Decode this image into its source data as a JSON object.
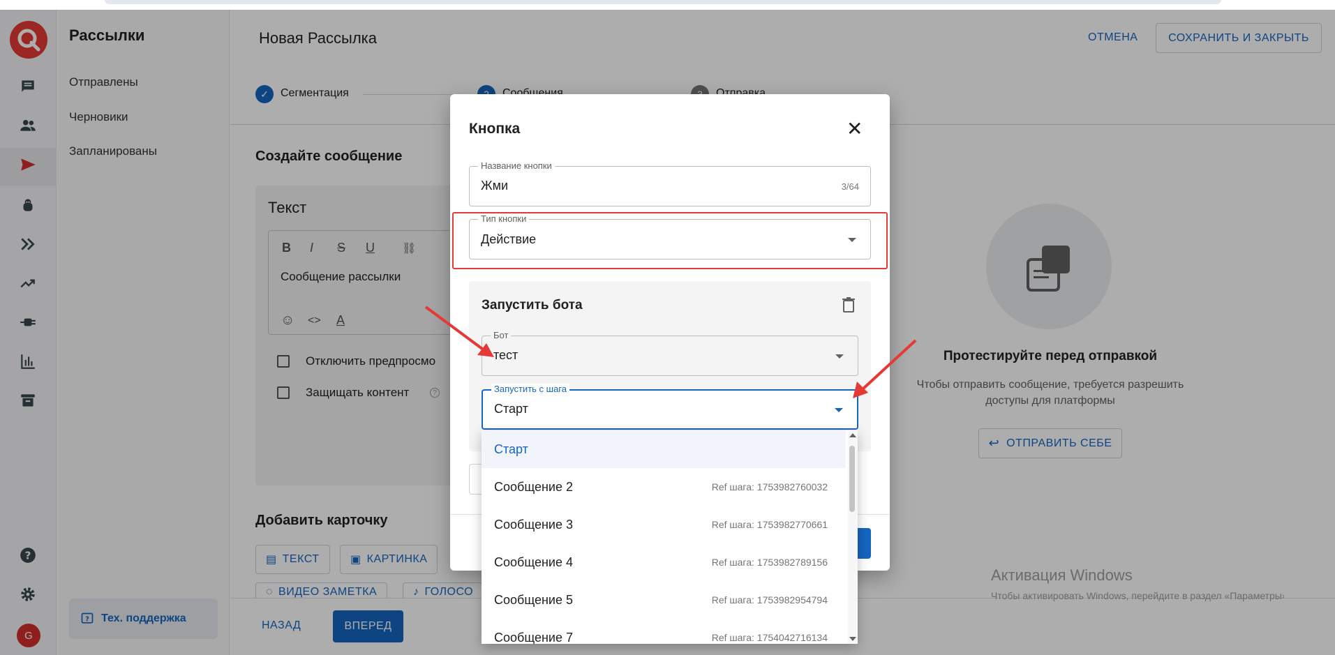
{
  "colors": {
    "accent": "#1565c0",
    "danger": "#e53935"
  },
  "rail": {
    "icons": [
      "chat-icon",
      "people-icon",
      "send-icon",
      "bot-icon",
      "forward-icon",
      "trending-icon",
      "plug-icon",
      "bar-chart-icon",
      "archive-icon",
      "help-icon",
      "gear-icon"
    ],
    "avatar_letter": "G"
  },
  "sidebar": {
    "title": "Рассылки",
    "items": [
      {
        "label": "Отправлены"
      },
      {
        "label": "Черновики"
      },
      {
        "label": "Запланированы"
      }
    ],
    "support_label": "Тех. поддержка"
  },
  "header": {
    "title": "Новая Рассылка",
    "cancel_label": "ОТМЕНА",
    "save_label": "СОХРАНИТЬ И ЗАКРЫТЬ"
  },
  "stepper": {
    "steps": [
      {
        "label": "Сегментация",
        "num": "✓"
      },
      {
        "label": "Сообщения",
        "num": "2"
      },
      {
        "label": "Отправка",
        "num": "3"
      }
    ]
  },
  "editor": {
    "section_title": "Создайте сообщение",
    "card_title": "Текст",
    "message_text": "Сообщение рассылки",
    "checkbox_disable_preview": "Отключить предпросмо",
    "checkbox_protect": "Защищать контент"
  },
  "add_card": {
    "title": "Добавить карточку",
    "chips": [
      "ТЕКСТ",
      "КАРТИНКА",
      "ВИДЕО ЗАМЕТКА",
      "ГОЛОСО"
    ]
  },
  "footer": {
    "back_label": "НАЗАД",
    "next_label": "ВПЕРЕД"
  },
  "preview": {
    "title": "Протестируйте перед отправкой",
    "description": "Чтобы отправить сообщение, требуется разрешить доступы для платформы",
    "send_self_label": "ОТПРАВИТЬ СЕБЕ",
    "watermark_title": "Активация Windows",
    "watermark_sub": "Чтобы активировать Windows, перейдите в раздел «Параметры»."
  },
  "dialog": {
    "title": "Кнопка",
    "name_field": {
      "label": "Название кнопки",
      "value": "Жми",
      "counter": "3/64"
    },
    "type_field": {
      "label": "Тип кнопки",
      "value": "Действие"
    },
    "action": {
      "title": "Запустить бота",
      "bot_field": {
        "label": "Бот",
        "value": "тест"
      },
      "step_field": {
        "label": "Запустить с шага",
        "value": "Старт"
      }
    }
  },
  "dropdown": {
    "options": [
      {
        "label": "Старт",
        "ref": ""
      },
      {
        "label": "Сообщение 2",
        "ref": "Ref шага: 1753982760032"
      },
      {
        "label": "Сообщение 3",
        "ref": "Ref шага: 1753982770661"
      },
      {
        "label": "Сообщение 4",
        "ref": "Ref шага: 1753982789156"
      },
      {
        "label": "Сообщение 5",
        "ref": "Ref шага: 1753982954794"
      },
      {
        "label": "Сообщение 7",
        "ref": "Ref шага: 1754042716134"
      }
    ]
  }
}
